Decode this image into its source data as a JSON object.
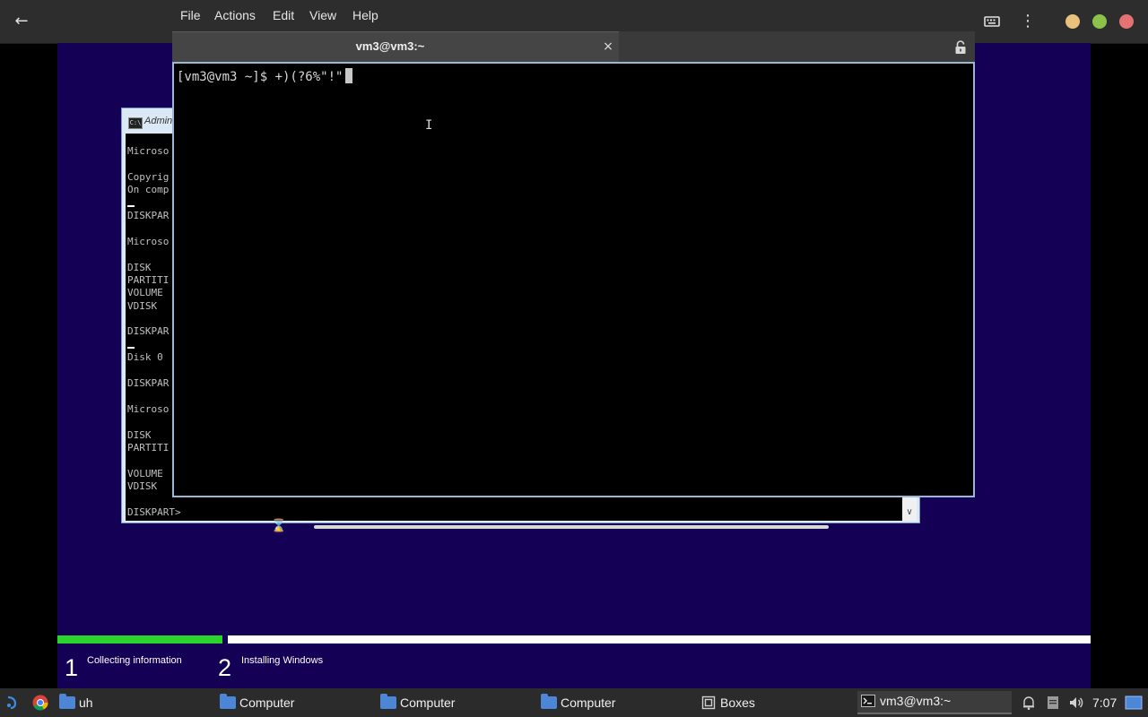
{
  "boxes_header": {
    "back_icon": "arrow-left-icon",
    "keyboard_icon": "keyboard-icon",
    "menu_icon": "vertical-dots-icon",
    "window_buttons": {
      "minimize": "#e8c27b",
      "maximize": "#8bc34a",
      "close": "#e57373"
    }
  },
  "terminal": {
    "menu": [
      "File",
      "Actions",
      "Edit",
      "View",
      "Help"
    ],
    "tab_title": "vm3@vm3:~",
    "tab_close": "×",
    "prompt_line": "[vm3@vm3 ~]$ +)(?6%\"!\""
  },
  "cmd": {
    "title": "Admin",
    "lines": [
      "Microso",
      "Copyrig",
      "On comp",
      "DISKPAR",
      "Microso",
      "DISK",
      "PARTITI",
      "VOLUME",
      "VDISK",
      "DISKPAR",
      "Disk 0",
      "DISKPAR",
      "Microso",
      "DISK",
      "PARTITI",
      "VOLUME",
      "VDISK",
      "DISKPART>"
    ]
  },
  "setup": {
    "progress": 0.16,
    "steps": [
      {
        "num": "1",
        "label": "Collecting information"
      },
      {
        "num": "2",
        "label": "Installing Windows"
      }
    ],
    "accent": "#2ad42a",
    "background": "#140054"
  },
  "taskbar": {
    "items": [
      {
        "label": "uh"
      },
      {
        "label": "Computer"
      },
      {
        "label": "Computer"
      },
      {
        "label": "Computer"
      },
      {
        "label": "Boxes"
      },
      {
        "label": "vm3@vm3:~"
      }
    ],
    "clock": "7:07"
  }
}
